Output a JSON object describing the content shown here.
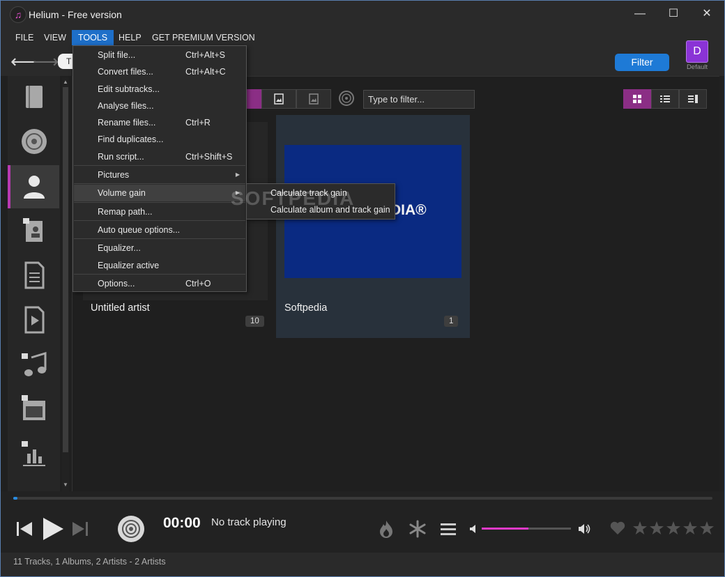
{
  "window": {
    "title": "Helium - Free version",
    "app_icon": "music-note-icon"
  },
  "menu": {
    "items": [
      {
        "label": "FILE"
      },
      {
        "label": "VIEW"
      },
      {
        "label": "TOOLS",
        "active": true
      },
      {
        "label": "HELP"
      },
      {
        "label": "GET PREMIUM VERSION"
      }
    ]
  },
  "toolbar": {
    "search_initial": "T",
    "filter_label": "Filter",
    "profile_letter": "D",
    "profile_label": "Default"
  },
  "tools_menu": {
    "items": [
      {
        "label": "Split file...",
        "shortcut": "Ctrl+Alt+S"
      },
      {
        "label": "Convert files...",
        "shortcut": "Ctrl+Alt+C"
      },
      {
        "label": "Edit subtracks...",
        "shortcut": ""
      },
      {
        "label": "Analyse files...",
        "shortcut": ""
      },
      {
        "label": "Rename files...",
        "shortcut": "Ctrl+R"
      },
      {
        "label": "Find duplicates...",
        "shortcut": ""
      },
      {
        "label": "Run script...",
        "shortcut": "Ctrl+Shift+S"
      },
      {
        "label": "Pictures",
        "submenu": true
      },
      {
        "label": "Volume gain",
        "submenu": true,
        "highlighted": true
      },
      {
        "label": "Remap path..."
      },
      {
        "label": "Auto queue options..."
      },
      {
        "label": "Equalizer..."
      },
      {
        "label": "Equalizer active"
      },
      {
        "label": "Options...",
        "shortcut": "Ctrl+O"
      }
    ],
    "volume_gain_submenu": [
      "Calculate track gain",
      "Calculate album and track gain"
    ]
  },
  "filter": {
    "placeholder": "Type to filter..."
  },
  "artists": [
    {
      "name": "Untitled artist",
      "count": "10"
    },
    {
      "name": "Softpedia",
      "count": "1",
      "art_text": "DIA®"
    }
  ],
  "watermark": "SOFTPEDIA",
  "player": {
    "time": "00:00",
    "now_playing": "No track playing",
    "progress_fraction": 0.0,
    "volume_fraction": 0.52
  },
  "status": {
    "text": "11 Tracks, 1 Albums, 2 Artists - 2 Artists"
  },
  "colors": {
    "accent": "#1e7ad6",
    "pink": "#b83ab1",
    "volume": "#e23ac8"
  }
}
